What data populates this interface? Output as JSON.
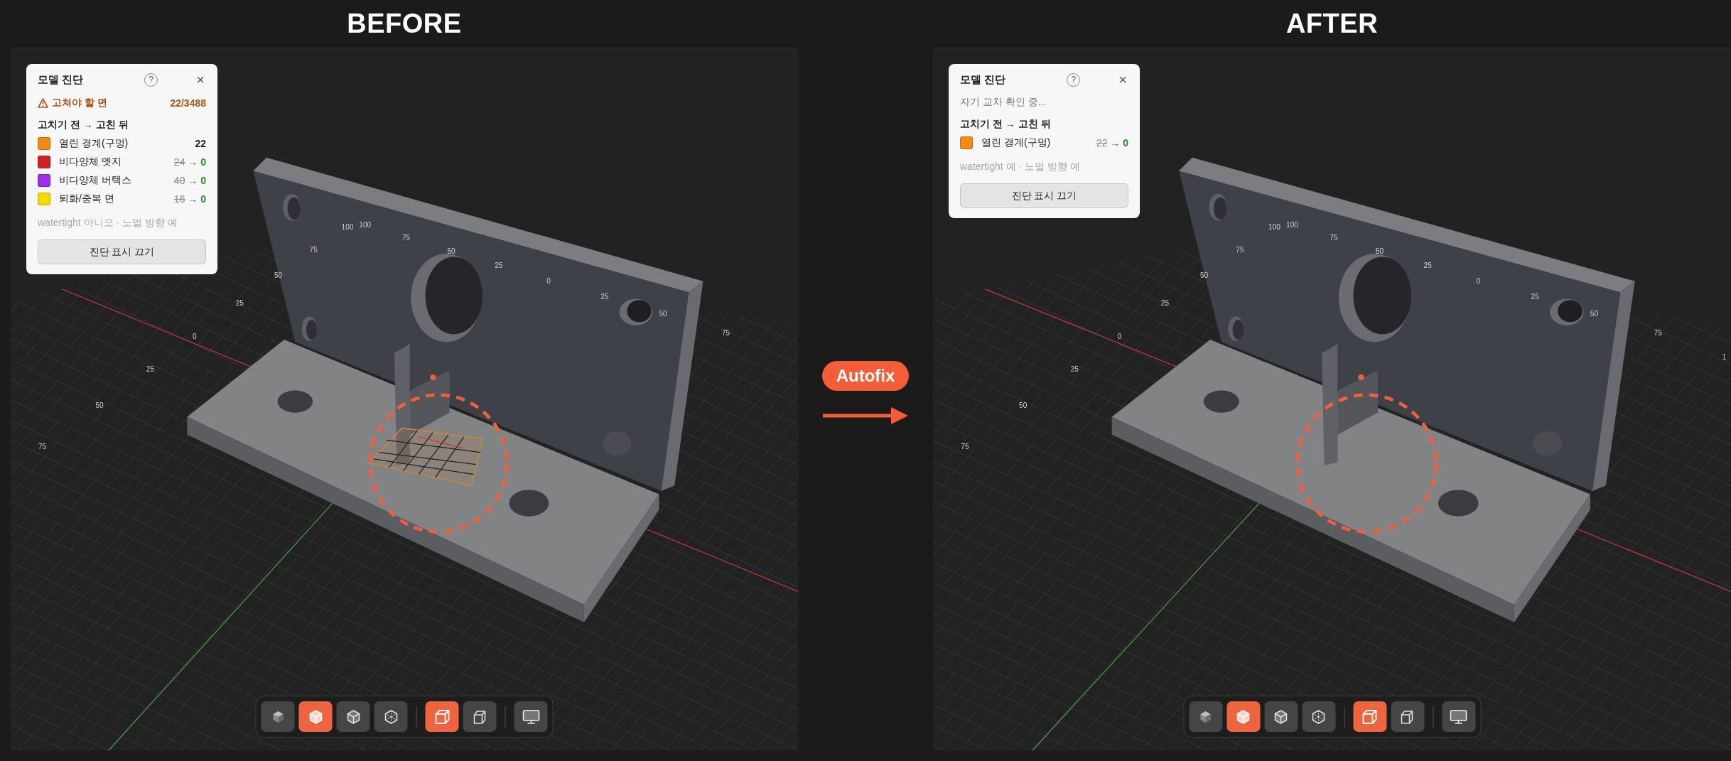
{
  "comparison": [
    {
      "title": "BEFORE",
      "diagnostics": {
        "title": "모델 진단",
        "help": "?",
        "close": "×",
        "warning": {
          "label": "고쳐야 할 면",
          "count": "22/3488"
        },
        "section": "고치기 전 → 고친 뒤",
        "rows": [
          {
            "kind": "count",
            "color": "#f08c14",
            "label": "열린 경계(구멍)",
            "value": "22"
          },
          {
            "kind": "change",
            "color": "#cc2424",
            "label": "비다양체 엣지",
            "before": "24",
            "arrow": "→",
            "after": "0"
          },
          {
            "kind": "change",
            "color": "#a02ee8",
            "label": "비다양체 버텍스",
            "before": "40",
            "arrow": "→",
            "after": "0"
          },
          {
            "kind": "change",
            "color": "#f5d800",
            "label": "퇴화/중복 면",
            "before": "16",
            "arrow": "→",
            "after": "0"
          }
        ],
        "mesh_status": "watertight 아니오 · 노멀 방향 예",
        "button": "진단 표시 끄기"
      },
      "viewport": {
        "defect_highlight": true,
        "axis_labels": [
          "100",
          "100",
          "75",
          "75",
          "50",
          "50",
          "25",
          "0",
          "25",
          "50",
          "75",
          "25",
          "0",
          "25",
          "50",
          "75"
        ]
      },
      "toolbar": [
        [
          {
            "selected": false
          },
          {
            "selected": true
          },
          {
            "selected": false
          },
          {
            "selected": false
          }
        ],
        [
          {
            "selected": true
          },
          {
            "selected": false
          }
        ],
        [
          {
            "selected": false
          }
        ]
      ]
    },
    {
      "title": "AFTER",
      "diagnostics": {
        "title": "모델 진단",
        "help": "?",
        "close": "×",
        "status": "자기 교차 확인 중...",
        "section": "고치기 전 → 고친 뒤",
        "rows": [
          {
            "kind": "change",
            "color": "#f08c14",
            "label": "열린 경계(구멍)",
            "before": "22",
            "arrow": "→",
            "after": "0"
          }
        ],
        "mesh_status": "watertight 예 · 노멀 방향 예",
        "button": "진단 표시 끄기"
      },
      "viewport": {
        "defect_highlight": false,
        "axis_labels": [
          "100",
          "100",
          "75",
          "75",
          "50",
          "50",
          "25",
          "0",
          "25",
          "50",
          "75",
          "25",
          "0",
          "25",
          "50",
          "75",
          "1"
        ]
      },
      "toolbar": [
        [
          {
            "selected": false
          },
          {
            "selected": true
          },
          {
            "selected": false
          },
          {
            "selected": false
          }
        ],
        [
          {
            "selected": true
          },
          {
            "selected": false
          }
        ],
        [
          {
            "selected": false
          }
        ]
      ]
    }
  ],
  "transition": {
    "label": "Autofix"
  }
}
